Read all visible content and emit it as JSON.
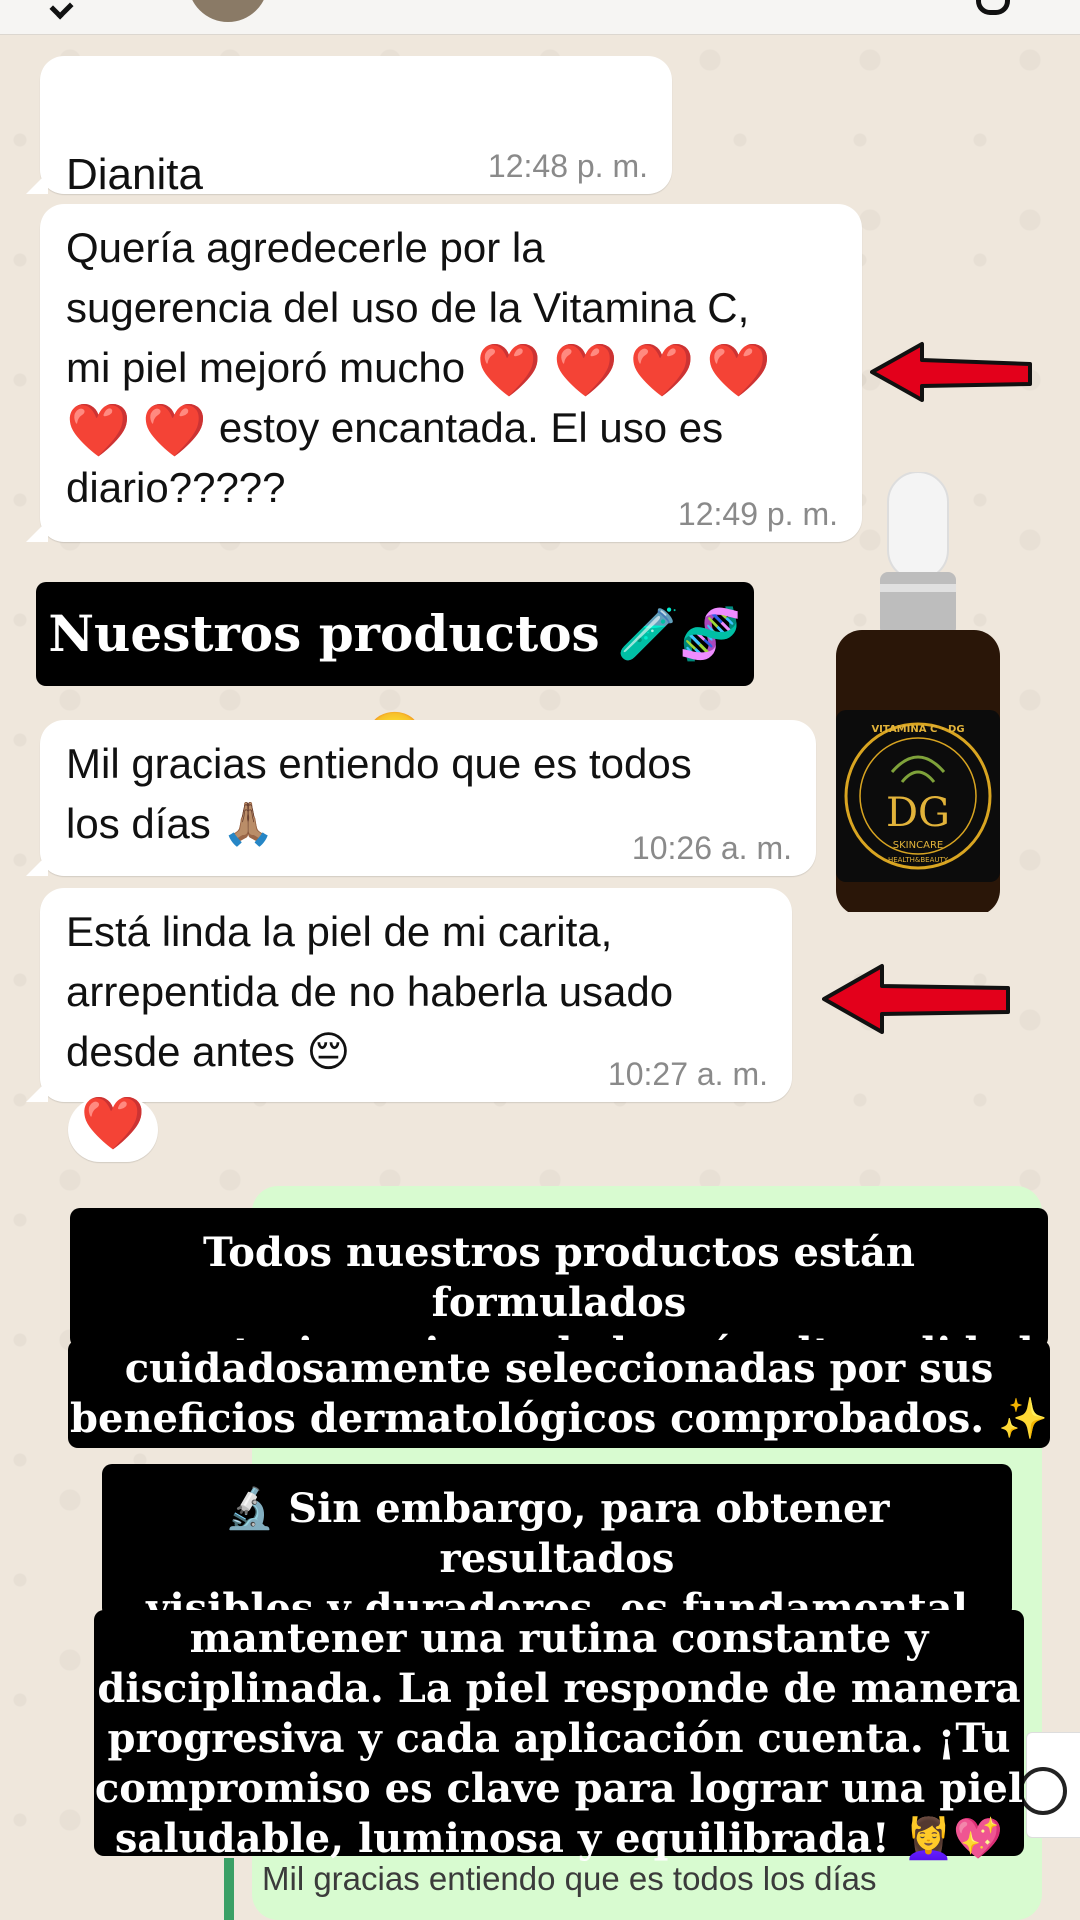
{
  "messages": [
    {
      "text": "Dianita",
      "hearts": 6,
      "time": "12:48 p. m."
    },
    {
      "line1": "Quería agredecerle por la",
      "line2": "sugerencia del uso de la Vitamina C,",
      "line3": "mi piel mejoró mucho",
      "line4_suffix": " estoy encantada. El uso es",
      "line5": "diario?????",
      "time": "12:49 p. m."
    },
    {
      "line1": "Mil gracias entiendo que es todos",
      "line2": "los días",
      "emoji": "🙏🏽",
      "time": "10:26 a. m."
    },
    {
      "line1": "Está linda la piel de mi carita,",
      "line2": "arrepentida de no haberla usado",
      "line3": "desde antes",
      "emoji": "😔",
      "time": "10:27 a. m."
    }
  ],
  "reaction": "❤️",
  "captions": {
    "products": "Nuestros productos 🧪🧬😍",
    "quality": [
      "Todos nuestros productos están formulados",
      "con materias primas de la más alta calidad,",
      "cuidadosamente seleccionadas por sus",
      "beneficios dermatológicos comprobados. ✨"
    ],
    "routine": [
      "🔬 Sin embargo, para obtener resultados",
      "visibles y duraderos, es fundamental",
      "mantener una rutina constante y",
      "disciplinada. La piel responde de manera",
      "progresiva y cada aplicación cuenta. ¡Tu",
      "compromiso es clave para lograr una piel",
      "saludable, luminosa y equilibrada! 💆‍♀️💖"
    ]
  },
  "bottle": {
    "label_top": "VITAMINA C · DG",
    "logo": "DG",
    "line1": "SKINCARE",
    "line2": "HEALTH&BEAUTY"
  },
  "quoted_reply": "Mil gracias entiendo que es todos los días",
  "colors": {
    "heart": "#e3001b",
    "arrow": "#e3001b",
    "chat_bg": "#efe7dc",
    "outgoing": "#d8fbd0"
  }
}
